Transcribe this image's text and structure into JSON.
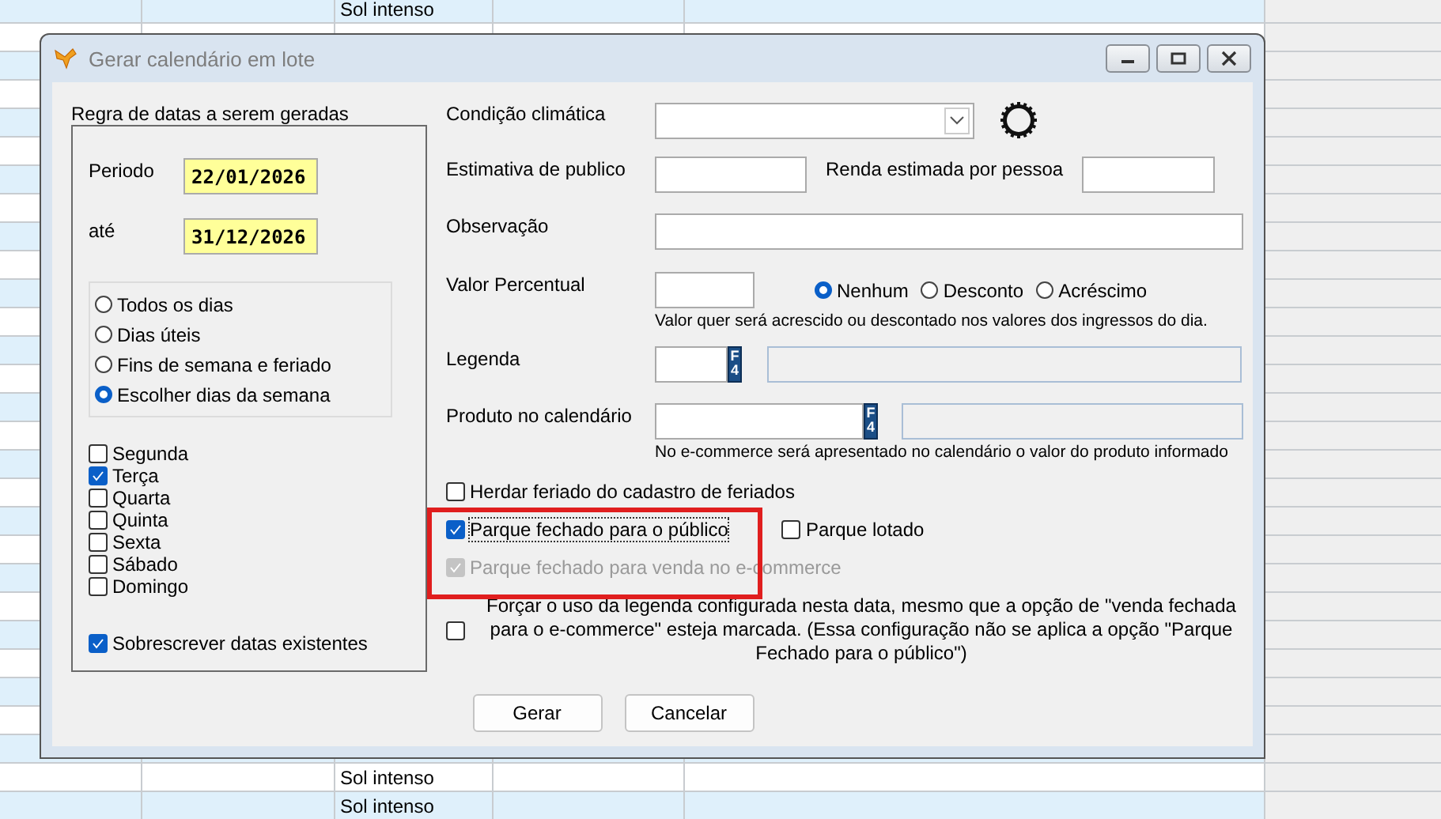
{
  "background_table": {
    "top_rows": [
      {
        "column_3": "Sol intenso"
      }
    ],
    "bottom_rows": [
      {
        "column_3": "Sol intenso"
      },
      {
        "column_3": "Sol intenso"
      }
    ]
  },
  "window": {
    "title": "Gerar calendário em lote"
  },
  "date_rule": {
    "title": "Regra de datas a serem geradas",
    "period_label": "Periodo",
    "period_from": "22/01/2026",
    "until_label": "até",
    "period_to": "31/12/2026",
    "rules": [
      {
        "label": "Todos os dias",
        "selected": false
      },
      {
        "label": "Dias úteis",
        "selected": false
      },
      {
        "label": "Fins de semana e feriado",
        "selected": false
      },
      {
        "label": "Escolher dias da semana",
        "selected": true
      }
    ],
    "weekdays": [
      {
        "label": "Segunda",
        "checked": false
      },
      {
        "label": "Terça",
        "checked": true
      },
      {
        "label": "Quarta",
        "checked": false
      },
      {
        "label": "Quinta",
        "checked": false
      },
      {
        "label": "Sexta",
        "checked": false
      },
      {
        "label": "Sábado",
        "checked": false
      },
      {
        "label": "Domingo",
        "checked": false
      }
    ],
    "overwrite": {
      "label": "Sobrescrever datas existentes",
      "checked": true
    }
  },
  "climate": {
    "label": "Condição climática"
  },
  "audience": {
    "label": "Estimativa de publico"
  },
  "income": {
    "label": "Renda estimada por pessoa"
  },
  "note": {
    "label": "Observação"
  },
  "percent": {
    "label": "Valor Percentual",
    "options": [
      {
        "label": "Nenhum",
        "selected": true
      },
      {
        "label": "Desconto",
        "selected": false
      },
      {
        "label": "Acréscimo",
        "selected": false
      }
    ],
    "hint": "Valor quer será acrescido ou descontado nos valores dos ingressos do dia."
  },
  "legend": {
    "label": "Legenda",
    "shortcut": "F4"
  },
  "product": {
    "label": "Produto no calendário",
    "shortcut": "F4",
    "hint": "No e-commerce será apresentado no calendário o valor do produto informado"
  },
  "inherit_holidays": {
    "label": "Herdar feriado do cadastro de feriados",
    "checked": false
  },
  "closed_public": {
    "label": "Parque fechado para o público",
    "checked": true,
    "focused": true
  },
  "park_full": {
    "label": "Parque lotado",
    "checked": false
  },
  "closed_ecommerce": {
    "label": "Parque fechado para venda no e-commerce",
    "checked": true,
    "disabled": true
  },
  "force_legend": {
    "label": "Forçar o uso da legenda configurada nesta data, mesmo que a opção de \"venda fechada para o e-commerce\" esteja marcada. (Essa configuração não se aplica a opção \"Parque Fechado para o público\")",
    "checked": false
  },
  "buttons": [
    "Gerar",
    "Cancelar"
  ]
}
